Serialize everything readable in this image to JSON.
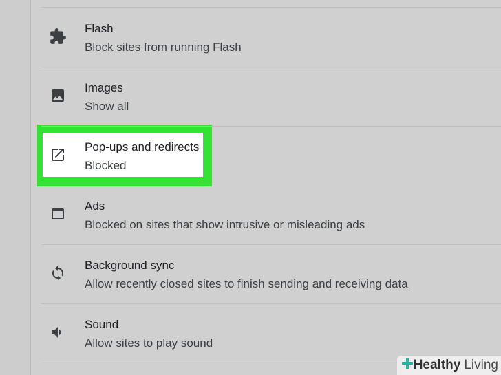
{
  "settings": {
    "items": [
      {
        "title": "Flash",
        "subtitle": "Block sites from running Flash",
        "icon": "puzzle-icon"
      },
      {
        "title": "Images",
        "subtitle": "Show all",
        "icon": "image-icon"
      },
      {
        "title": "Pop-ups and redirects",
        "subtitle": "Blocked",
        "icon": "open-in-new-icon"
      },
      {
        "title": "Ads",
        "subtitle": "Blocked on sites that show intrusive or misleading ads",
        "icon": "window-icon"
      },
      {
        "title": "Background sync",
        "subtitle": "Allow recently closed sites to finish sending and receiving data",
        "icon": "sync-icon"
      },
      {
        "title": "Sound",
        "subtitle": "Allow sites to play sound",
        "icon": "volume-icon"
      }
    ],
    "highlighted_item": "Pop-ups and redirects"
  },
  "colors": {
    "highlight": "#33e233",
    "background": "#d0d0d0",
    "text_primary": "#202124",
    "text_secondary": "#3c4043"
  },
  "watermark": {
    "text_a": "Healthy",
    "text_b": "Living"
  }
}
